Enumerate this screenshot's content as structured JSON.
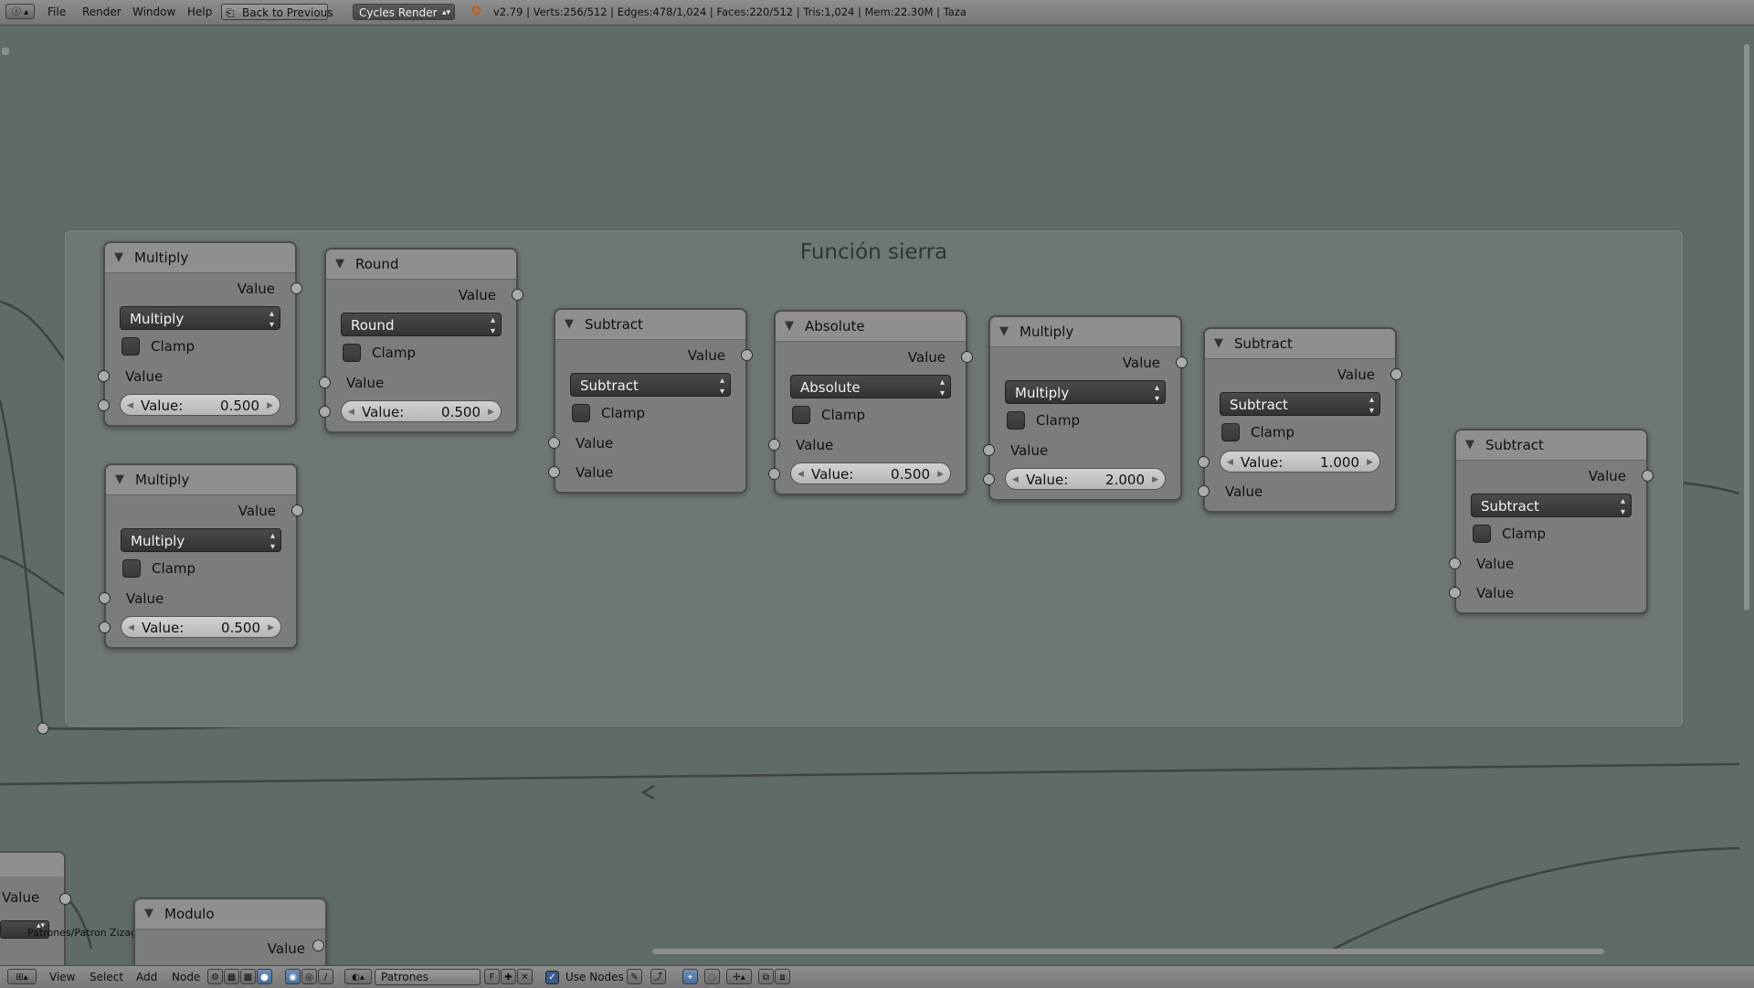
{
  "topbar": {
    "menu": [
      "File",
      "Render",
      "Window",
      "Help"
    ],
    "back_button": "Back to Previous",
    "engine": "Cycles Render",
    "stats": "v2.79 | Verts:256/512 | Edges:478/1,024 | Faces:220/512 | Tris:1,024 | Mem:22.30M | Taza"
  },
  "frame": {
    "title": "Función sierra"
  },
  "nodes": {
    "n1": {
      "title": "Multiply",
      "out": "Value",
      "op": "Multiply",
      "clamp": "Clamp",
      "in1": "Value",
      "field_label": "Value:",
      "field_value": "0.500"
    },
    "n2": {
      "title": "Multiply",
      "out": "Value",
      "op": "Multiply",
      "clamp": "Clamp",
      "in1": "Value",
      "field_label": "Value:",
      "field_value": "0.500"
    },
    "n3": {
      "title": "Round",
      "out": "Value",
      "op": "Round",
      "clamp": "Clamp",
      "in1": "Value",
      "field_label": "Value:",
      "field_value": "0.500"
    },
    "n4": {
      "title": "Subtract",
      "out": "Value",
      "op": "Subtract",
      "clamp": "Clamp",
      "in1": "Value",
      "in2": "Value"
    },
    "n5": {
      "title": "Absolute",
      "out": "Value",
      "op": "Absolute",
      "clamp": "Clamp",
      "in1": "Value",
      "field_label": "Value:",
      "field_value": "0.500"
    },
    "n6": {
      "title": "Multiply",
      "out": "Value",
      "op": "Multiply",
      "clamp": "Clamp",
      "in1": "Value",
      "field_label": "Value:",
      "field_value": "2.000"
    },
    "n7": {
      "title": "Subtract",
      "out": "Value",
      "op": "Subtract",
      "clamp": "Clamp",
      "field_label": "Value:",
      "field_value": "1.000",
      "in2": "Value"
    },
    "n8": {
      "title": "Subtract",
      "out": "Value",
      "op": "Subtract",
      "clamp": "Clamp",
      "in1": "Value",
      "in2": "Value"
    },
    "bl": {
      "out": "Value",
      "group": "Patrones/Patron Zizag"
    },
    "mod": {
      "title": "Modulo",
      "out": "Value"
    }
  },
  "bottombar": {
    "menu": [
      "View",
      "Select",
      "Add",
      "Node"
    ],
    "tree_name": "Patrones",
    "fake_user": "F",
    "use_nodes_label": "Use Nodes"
  },
  "colors": {
    "canvas_bg": "#5f6b66",
    "frame_bg": "#6e7873",
    "node_body": "#7b7c7c",
    "node_header": "#8f8f90",
    "link": "#3e4340"
  }
}
